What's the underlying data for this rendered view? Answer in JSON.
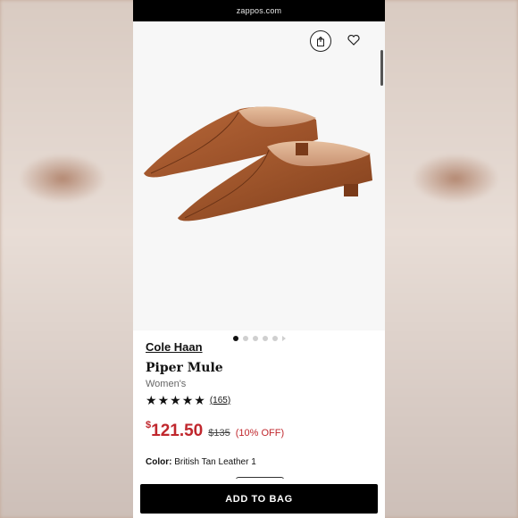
{
  "browser": {
    "url": "zappos.com"
  },
  "product": {
    "brand": "Cole Haan",
    "name": "Piper Mule",
    "gender": "Women's",
    "rating_stars": 5,
    "review_count": "(165)",
    "price_currency": "$",
    "price_amount": "121.50",
    "original_price": "$135",
    "discount": "(10% OFF)",
    "color_label": "Color:",
    "color_value": "British Tan Leather 1"
  },
  "gallery": {
    "image_count": 5,
    "active_index": 0
  },
  "actions": {
    "add_to_bag": "ADD TO BAG"
  },
  "colors": {
    "price": "#c0272d",
    "shoe": "#a0532b"
  },
  "icons": [
    "share-icon",
    "heart-icon",
    "star-icon"
  ]
}
